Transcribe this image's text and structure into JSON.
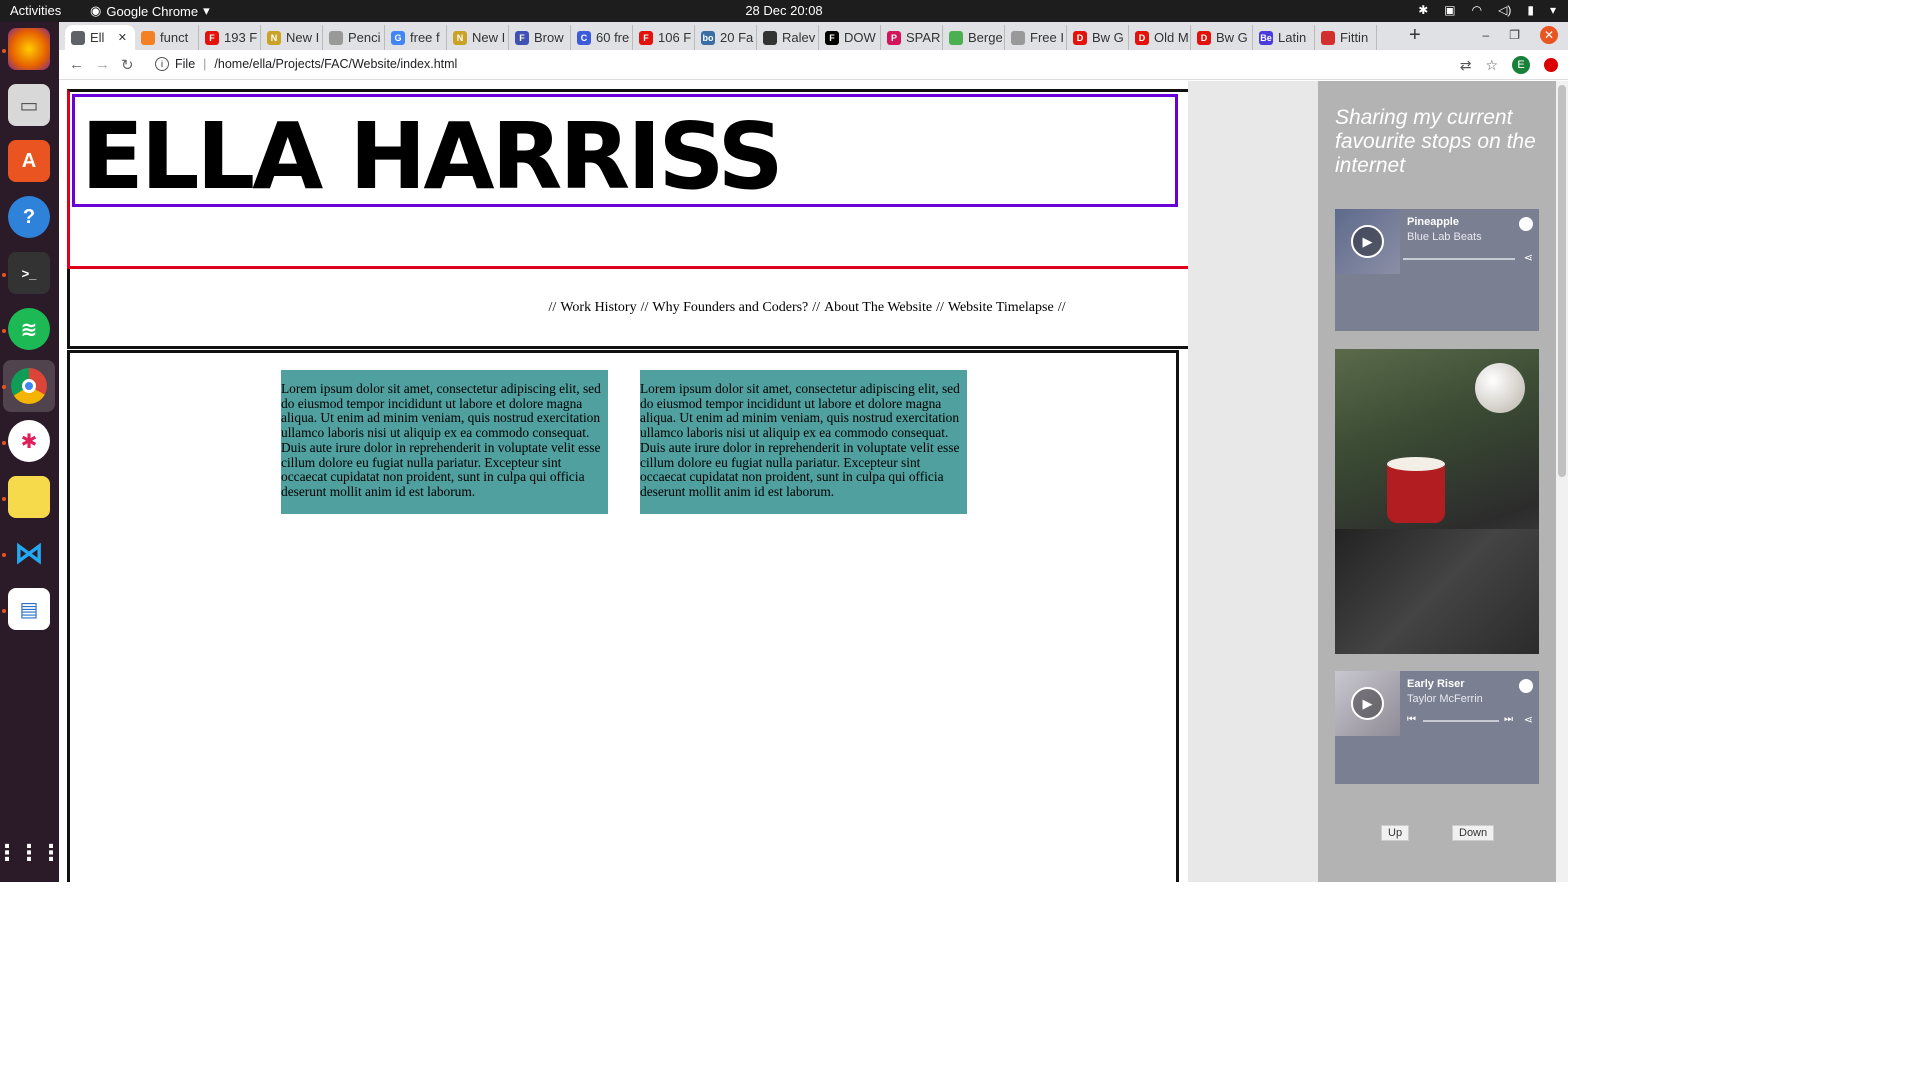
{
  "system": {
    "activities": "Activities",
    "app_name": "Google Chrome",
    "clock": "28 Dec  20:08"
  },
  "browser": {
    "tabs": [
      {
        "label": "Ell",
        "icon": "globe-icon",
        "color": "#5f6368"
      },
      {
        "label": "funct",
        "icon": "stack-icon",
        "color": "#f48024"
      },
      {
        "label": "193 F",
        "icon": "F",
        "color": "#e3120b"
      },
      {
        "label": "New I",
        "icon": "N",
        "color": "#c9a227"
      },
      {
        "label": "Penci",
        "icon": "pencil-icon",
        "color": "#999999"
      },
      {
        "label": "free f",
        "icon": "G",
        "color": "#4285f4"
      },
      {
        "label": "New I",
        "icon": "N",
        "color": "#c9a227"
      },
      {
        "label": "Brow",
        "icon": "F",
        "color": "#3f51b5"
      },
      {
        "label": "60 fre",
        "icon": "C",
        "color": "#3b5bdb"
      },
      {
        "label": "106 F",
        "icon": "F",
        "color": "#e3120b"
      },
      {
        "label": "20 Fa",
        "icon": "bo",
        "color": "#3a6ea5"
      },
      {
        "label": "Ralev",
        "icon": "circle-icon",
        "color": "#333333"
      },
      {
        "label": "DOW",
        "icon": "F",
        "color": "#000000"
      },
      {
        "label": "SPAR",
        "icon": "P",
        "color": "#d4145a"
      },
      {
        "label": "Berge",
        "icon": "leaf-icon",
        "color": "#4caf50"
      },
      {
        "label": "Free I",
        "icon": "circle-icon",
        "color": "#999999"
      },
      {
        "label": "Bw G",
        "icon": "D",
        "color": "#e3120b"
      },
      {
        "label": "Old M",
        "icon": "D",
        "color": "#e3120b"
      },
      {
        "label": "Bw G",
        "icon": "D",
        "color": "#e3120b"
      },
      {
        "label": "Latin",
        "icon": "Be",
        "color": "#4b3bdb"
      },
      {
        "label": "Fittin",
        "icon": "ball-icon",
        "color": "#d32f2f"
      }
    ],
    "protocol": "File",
    "url": "/home/ella/Projects/FAC/Website/index.html",
    "profile_initial": "E"
  },
  "page": {
    "title": "ELLA HARRISS",
    "nav": {
      "sep": "//",
      "links": [
        "Work History",
        "Why Founders and Coders?",
        "About The Website",
        "Website Timelapse"
      ]
    },
    "cards": [
      "Lorem ipsum dolor sit amet, consectetur adipiscing elit, sed do eiusmod tempor incididunt ut labore et dolore magna aliqua. Ut enim ad minim veniam, quis nostrud exercitation ullamco laboris nisi ut aliquip ex ea commodo consequat. Duis aute irure dolor in reprehenderit in voluptate velit esse cillum dolore eu fugiat nulla pariatur. Excepteur sint occaecat cupidatat non proident, sunt in culpa qui officia deserunt mollit anim id est laborum.",
      "Lorem ipsum dolor sit amet, consectetur adipiscing elit, sed do eiusmod tempor incididunt ut labore et dolore magna aliqua. Ut enim ad minim veniam, quis nostrud exercitation ullamco laboris nisi ut aliquip ex ea commodo consequat. Duis aute irure dolor in reprehenderit in voluptate velit esse cillum dolore eu fugiat nulla pariatur. Excepteur sint occaecat cupidatat non proident, sunt in culpa qui officia deserunt mollit anim id est laborum."
    ],
    "sidebar": {
      "tagline": "Sharing my current favourite stops on the internet",
      "players": [
        {
          "track": "Pineapple",
          "artist": "Blue Lab Beats"
        },
        {
          "track": "Early Riser",
          "artist": "Taylor McFerrin"
        }
      ],
      "up_label": "Up",
      "down_label": "Down"
    }
  }
}
